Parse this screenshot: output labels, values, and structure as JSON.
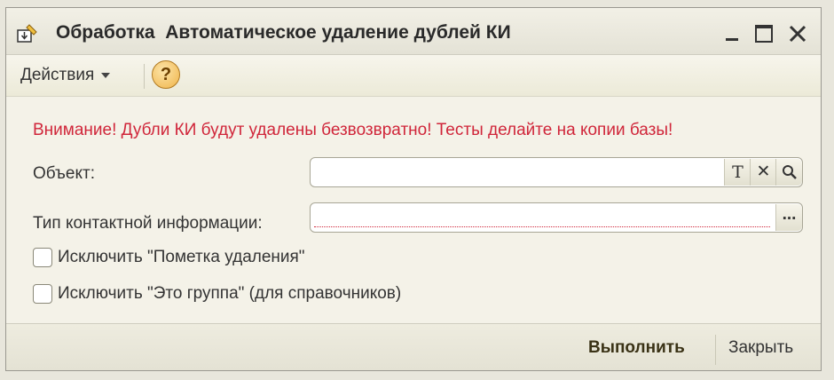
{
  "window": {
    "title": "Обработка  Автоматическое удаление дублей КИ"
  },
  "toolbar": {
    "actions_label": "Действия",
    "help_label": "?"
  },
  "form": {
    "warning": "Внимание! Дубли КИ будут удалены безвозвратно! Тесты делайте на копии базы!",
    "object_label": "Объект:",
    "object_value": "",
    "object_buttons": [
      "T",
      "✕",
      "search-icon"
    ],
    "contact_type_label": "Тип контактной информации:",
    "contact_type_value": "",
    "contact_type_button": "...",
    "exclude_deletion_mark": {
      "label": "Исключить \"Пометка удаления\"",
      "checked": false
    },
    "exclude_group": {
      "label": "Исключить \"Это группа\" (для справочников)",
      "checked": false
    }
  },
  "footer": {
    "run_label": "Выполнить",
    "close_label": "Закрыть"
  },
  "colors": {
    "warning": "#d0263a",
    "background": "#f4f2e8"
  }
}
